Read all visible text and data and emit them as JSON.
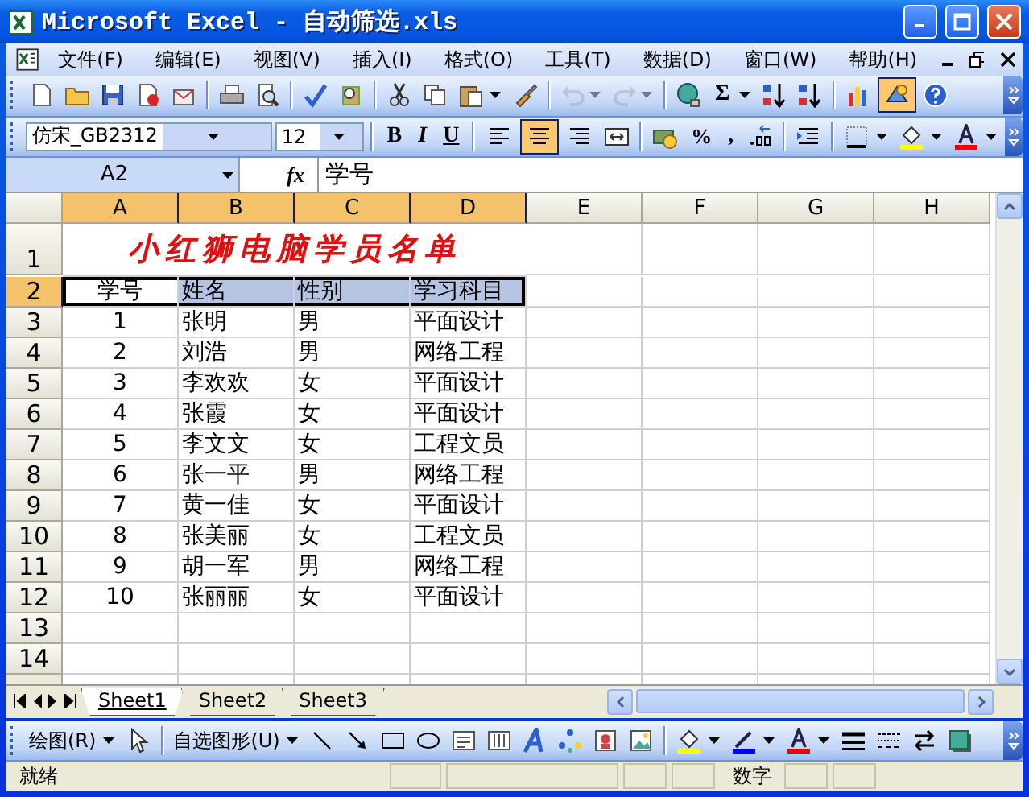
{
  "window": {
    "title": "Microsoft Excel - 自动筛选.xls"
  },
  "menu": [
    "文件(F)",
    "编辑(E)",
    "视图(V)",
    "插入(I)",
    "格式(O)",
    "工具(T)",
    "数据(D)",
    "窗口(W)",
    "帮助(H)"
  ],
  "standard_toolbar": {
    "undo": {
      "disabled": true
    },
    "redo": {
      "disabled": true
    },
    "autosum": "Σ",
    "drawing": {
      "selected": true
    }
  },
  "formatting_toolbar": {
    "font": "仿宋_GB2312",
    "size": "12",
    "bold": "B",
    "italic": "I",
    "underline": "U",
    "alignment": [
      {
        "selected": false
      },
      {
        "selected": true
      },
      {
        "selected": false
      }
    ],
    "percent": "%",
    "comma": ","
  },
  "formula_bar": {
    "name_box": "A2",
    "function_label": "fx",
    "value": "学号"
  },
  "sheet": {
    "columns": [
      {
        "label": "A",
        "selected": true
      },
      {
        "label": "B",
        "selected": true
      },
      {
        "label": "C",
        "selected": true
      },
      {
        "label": "D",
        "selected": true
      },
      {
        "label": "E",
        "selected": false
      },
      {
        "label": "F",
        "selected": false
      },
      {
        "label": "G",
        "selected": false
      },
      {
        "label": "H",
        "selected": false
      }
    ],
    "rows": [
      {
        "header": "1",
        "selected": false,
        "title": "小红狮电脑学员名单"
      },
      {
        "header": "2",
        "selected": true,
        "cells": [
          "学号",
          "姓名",
          "性别",
          "学习科目"
        ]
      },
      {
        "header": "3",
        "selected": false,
        "cells": [
          "1",
          "张明",
          "男",
          "平面设计"
        ]
      },
      {
        "header": "4",
        "selected": false,
        "cells": [
          "2",
          "刘浩",
          "男",
          "网络工程"
        ]
      },
      {
        "header": "5",
        "selected": false,
        "cells": [
          "3",
          "李欢欢",
          "女",
          "平面设计"
        ]
      },
      {
        "header": "6",
        "selected": false,
        "cells": [
          "4",
          "张霞",
          "女",
          "平面设计"
        ]
      },
      {
        "header": "7",
        "selected": false,
        "cells": [
          "5",
          "李文文",
          "女",
          "工程文员"
        ]
      },
      {
        "header": "8",
        "selected": false,
        "cells": [
          "6",
          "张一平",
          "男",
          "网络工程"
        ]
      },
      {
        "header": "9",
        "selected": false,
        "cells": [
          "7",
          "黄一佳",
          "女",
          "平面设计"
        ]
      },
      {
        "header": "10",
        "selected": false,
        "cells": [
          "8",
          "张美丽",
          "女",
          "工程文员"
        ]
      },
      {
        "header": "11",
        "selected": false,
        "cells": [
          "9",
          "胡一军",
          "男",
          "网络工程"
        ]
      },
      {
        "header": "12",
        "selected": false,
        "cells": [
          "10",
          "张丽丽",
          "女",
          "平面设计"
        ]
      },
      {
        "header": "13",
        "selected": false,
        "cells": []
      },
      {
        "header": "14",
        "selected": false,
        "cells": []
      }
    ]
  },
  "sheet_tabs": [
    {
      "label": "Sheet1",
      "selected": true
    },
    {
      "label": "Sheet2",
      "selected": false
    },
    {
      "label": "Sheet3",
      "selected": false
    }
  ],
  "drawing_toolbar": {
    "draw_menu": "绘图(R)",
    "autoshapes": "自选图形(U)"
  },
  "status_bar": {
    "status": "就绪",
    "mode": "数字"
  }
}
